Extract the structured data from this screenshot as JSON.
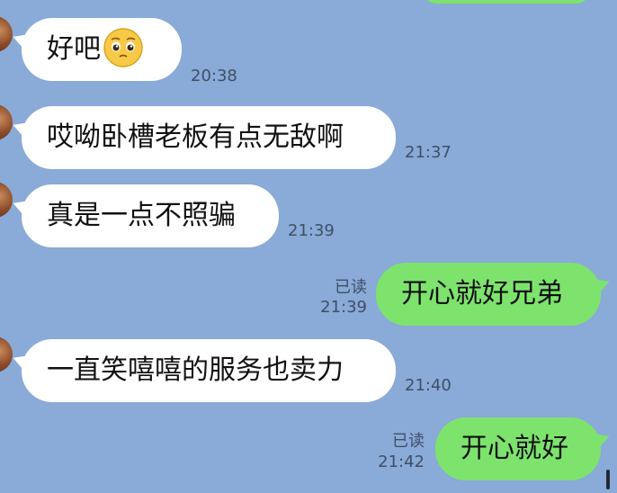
{
  "colors": {
    "background": "#8aaad8",
    "incoming_bubble": "#ffffff",
    "outgoing_bubble": "#7de36d",
    "meta_text": "#3f4f66"
  },
  "messages": [
    {
      "text": "好吧",
      "time": "20:38",
      "direction": "incoming",
      "emoji": "pleading-face-icon"
    },
    {
      "text": "哎呦卧槽老板有点无敌啊",
      "time": "21:37",
      "direction": "incoming"
    },
    {
      "text": "真是一点不照骗",
      "time": "21:39",
      "direction": "incoming"
    },
    {
      "text": "开心就好兄弟",
      "time": "21:39",
      "direction": "outgoing",
      "read_label": "已读"
    },
    {
      "text": "一直笑嘻嘻的服务也卖力",
      "time": "21:40",
      "direction": "incoming"
    },
    {
      "text": "开心就好",
      "time": "21:42",
      "direction": "outgoing",
      "read_label": "已读"
    }
  ]
}
